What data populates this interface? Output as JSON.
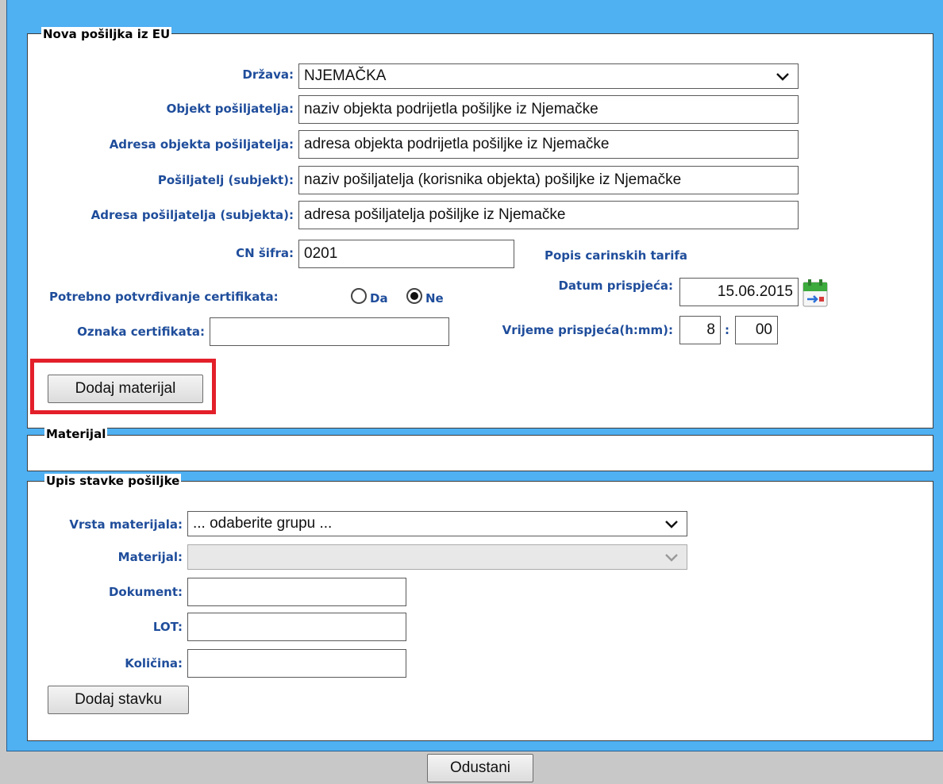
{
  "shipment": {
    "legend": "Nova pošiljka iz EU",
    "country_label": "Država:",
    "country_value": "NJEMAČKA",
    "object_label": "Objekt pošiljatelja:",
    "object_value": "naziv objekta podrijetla pošiljke iz Njemačke",
    "object_address_label": "Adresa objekta pošiljatelja:",
    "object_address_value": "adresa objekta podrijetla pošiljke iz Njemačke",
    "sender_label": "Pošiljatelj (subjekt):",
    "sender_value": "naziv pošiljatelja (korisnika objekta) pošiljke iz Njemačke",
    "sender_address_label": "Adresa pošiljatelja (subjekta):",
    "sender_address_value": "adresa pošiljatelja pošiljke iz Njemačke",
    "cn_label": "CN šifra:",
    "cn_value": "0201",
    "tariff_link": "Popis carinskih tarifa",
    "cert_required_label": "Potrebno potvrđivanje certifikata:",
    "cert_yes": "Da",
    "cert_no": "Ne",
    "cert_selected": "Ne",
    "arrival_date_label": "Datum prispjeća:",
    "arrival_date_value": "15.06.2015",
    "cert_mark_label": "Oznaka certifikata:",
    "cert_mark_value": "",
    "arrival_time_label": "Vrijeme prispjeća(h:mm):",
    "arrival_hour": "8",
    "time_separator": ":",
    "arrival_minute": "00",
    "add_material_button": "Dodaj materijal"
  },
  "material": {
    "legend": "Materijal"
  },
  "item_entry": {
    "legend": "Upis stavke pošiljke",
    "material_type_label": "Vrsta materijala:",
    "material_type_value": "... odaberite grupu ...",
    "material_label": "Materijal:",
    "material_value": "",
    "document_label": "Dokument:",
    "document_value": "",
    "lot_label": "LOT:",
    "lot_value": "",
    "quantity_label": "Količina:",
    "quantity_value": "",
    "add_item_button": "Dodaj stavku"
  },
  "footer": {
    "cancel_button": "Odustani"
  },
  "icons": {
    "calendar": "calendar-icon",
    "chevron": "chevron-down-icon"
  },
  "colors": {
    "background_blue": "#4fb0f2",
    "label_blue": "#1f4d9b",
    "highlight_red": "#e3202a"
  }
}
